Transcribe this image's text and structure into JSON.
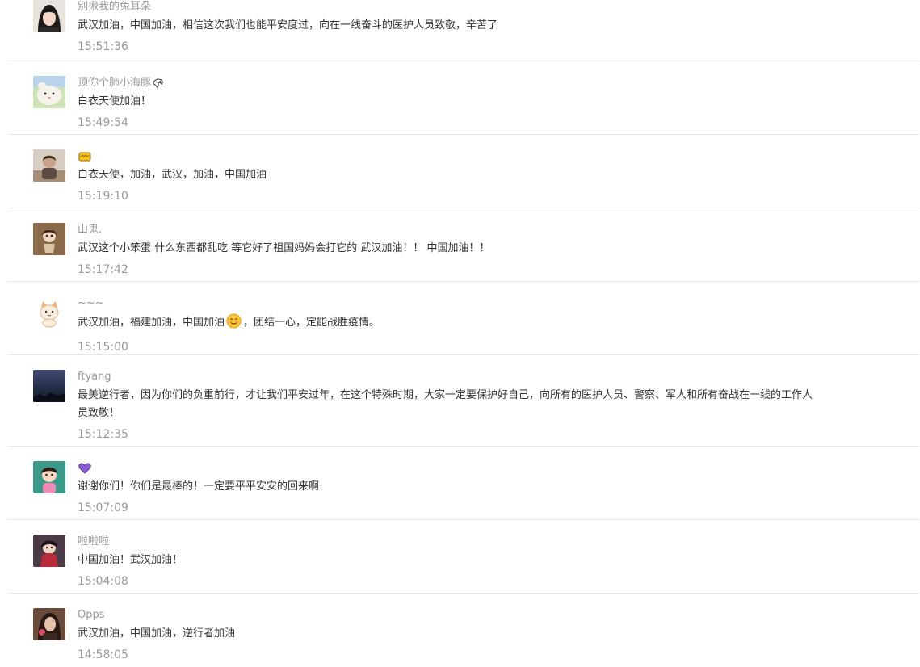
{
  "comments": [
    {
      "user": "别揪我的兔耳朵",
      "text": "武汉加油，中国加油，相信这次我们也能平安度过，向在一线奋斗的医护人员致敬，辛苦了",
      "time": "15:51:36",
      "avatar_icon": "girl-portrait-avatar"
    },
    {
      "user": "顶你个肺小海豚",
      "user_emoji": "dolphin-icon",
      "text": "白衣天使加油！",
      "time": "15:49:54",
      "avatar_icon": "cartoon-animal-avatar"
    },
    {
      "user": "",
      "user_emoji": "crown-icon",
      "text": "白衣天使，加油，武汉，加油，中国加油",
      "time": "15:19:10",
      "avatar_icon": "person-photo-avatar"
    },
    {
      "user": "山鬼.",
      "text": "武汉这个小笨蛋 什么东西都乱吃 等它好了祖国妈妈会打它的 武汉加油！！ 中国加油！！",
      "time": "15:17:42",
      "avatar_icon": "doll-avatar"
    },
    {
      "user": "~~~",
      "text_before": "武汉加油，福建加油，中国加油",
      "text_emoji": "smile-emoji-icon",
      "text_after": "，团结一心，定能战胜疫情。",
      "time": "15:15:00",
      "avatar_icon": "cat-cartoon-avatar"
    },
    {
      "user": "ftyang",
      "text": "最美逆行者，因为你们的负重前行，才让我们平安过年，在这个特殊时期，大家一定要保护好自己，向所有的医护人员、警察、军人和所有奋战在一线的工作人员致敬！",
      "time": "15:12:35",
      "avatar_icon": "night-sky-avatar"
    },
    {
      "user": "",
      "user_emoji": "purple-heart-icon",
      "text": "谢谢你们！你们是最棒的！一定要平平安安的回来啊",
      "time": "15:07:09",
      "avatar_icon": "cartoon-girl-avatar"
    },
    {
      "user": "啦啦啦",
      "text": "中国加油！武汉加油！",
      "time": "15:04:08",
      "avatar_icon": "anime-character-avatar"
    },
    {
      "user": "Opps",
      "text": "武汉加油，中国加油，逆行者加油",
      "time": "14:58:05",
      "avatar_icon": "woman-photo-avatar"
    }
  ]
}
